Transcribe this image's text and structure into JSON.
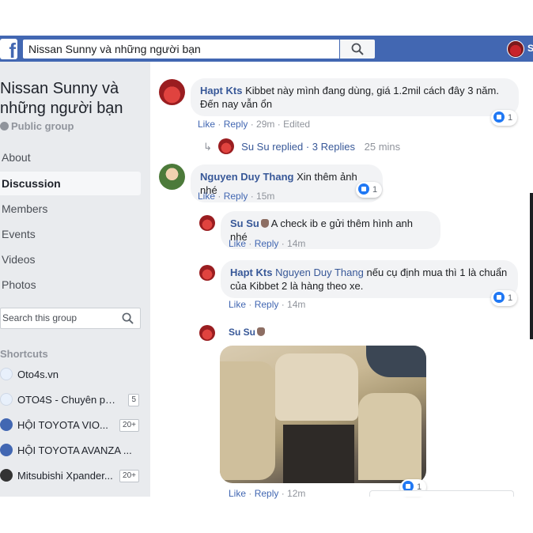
{
  "header": {
    "search_value": "Nissan Sunny và những người bạn",
    "logo_letter": "f",
    "user_initial": "S"
  },
  "sidebar": {
    "group_name": "Nissan Sunny và những người bạn",
    "privacy": "Public group",
    "nav": [
      "About",
      "Discussion",
      "Members",
      "Events",
      "Videos",
      "Photos"
    ],
    "active_nav": "Discussion",
    "search_placeholder": "Search this group",
    "shortcuts_title": "Shortcuts",
    "shortcuts": [
      {
        "label": "Oto4s.vn",
        "badge": "",
        "icon_color": "#ffffff"
      },
      {
        "label": "OTO4S - Chuyên ph...",
        "badge": "5",
        "icon_color": "#ffffff"
      },
      {
        "label": "HỘI TOYOTA VIO...",
        "badge": "20+",
        "icon_color": "#4267b2"
      },
      {
        "label": "HỘI TOYOTA AVANZA ...",
        "badge": "",
        "icon_color": "#4267b2"
      },
      {
        "label": "Mitsubishi Xpander...",
        "badge": "20+",
        "icon_color": "#333333"
      }
    ]
  },
  "comments": {
    "c1": {
      "author": "Hapt Kts",
      "text": "Kibbet này mình đang dùng, giá 1.2mil cách đây 3 năm. Đến nay vẫn ổn",
      "like": "Like",
      "reply": "Reply",
      "time": "29m",
      "edited": "Edited",
      "reactions": "1"
    },
    "replied": {
      "author": "Su Su",
      "action": "replied",
      "replies": "3 Replies",
      "time": "25 mins"
    },
    "c2": {
      "author": "Nguyen Duy Thang",
      "text": "Xin thêm ảnh nhé",
      "like": "Like",
      "reply": "Reply",
      "time": "15m",
      "reactions": "1"
    },
    "r1": {
      "author": "Su Su",
      "text": "A check ib e gửi thêm hình anh nhé",
      "like": "Like",
      "reply": "Reply",
      "time": "14m"
    },
    "r2": {
      "author": "Hapt Kts",
      "mention": "Nguyen Duy Thang",
      "text": "nếu cụ định mua thì 1 là chuẩn của Kibbet 2 là hàng theo xe.",
      "like": "Like",
      "reply": "Reply",
      "time": "14m",
      "reactions": "1"
    },
    "r3": {
      "author": "Su Su",
      "like": "Like",
      "reply": "Reply",
      "time": "12m",
      "reactions": "1"
    }
  },
  "colors": {
    "header_blue": "#4267b2",
    "link_blue": "#385898",
    "bubble_grey": "#f2f3f5",
    "sidebar_bg": "#e9ebee"
  }
}
